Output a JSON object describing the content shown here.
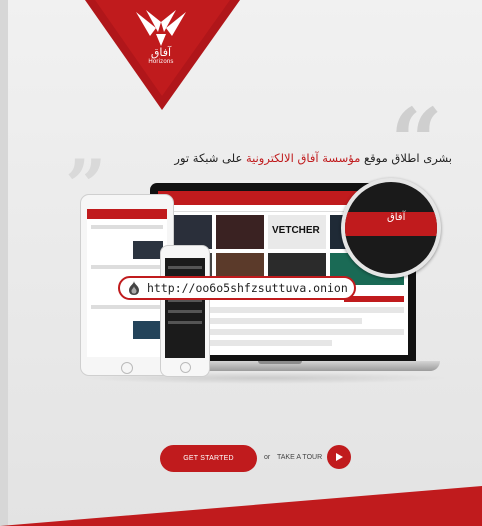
{
  "brand": {
    "logo_arabic": "آفاق",
    "logo_english": "Horizons",
    "accent_color": "#c01b1d"
  },
  "announcement": {
    "part1": "بشرى اطلاق موقع ",
    "highlight": "مؤسسة آفاق الالكترونية",
    "part2": " على شبكة تور"
  },
  "onion_url": {
    "icon": "onion-icon",
    "text": "http://oo6o5shfzsuttuva.onion"
  },
  "cta": {
    "primary_label": "GET STARTED",
    "or_text": "or",
    "tour_label": "TAKE A TOUR",
    "tour_icon": "play-icon"
  },
  "devices": {
    "laptop_banner_text": "VETCHER",
    "magnifier_logo": "آفاق"
  }
}
